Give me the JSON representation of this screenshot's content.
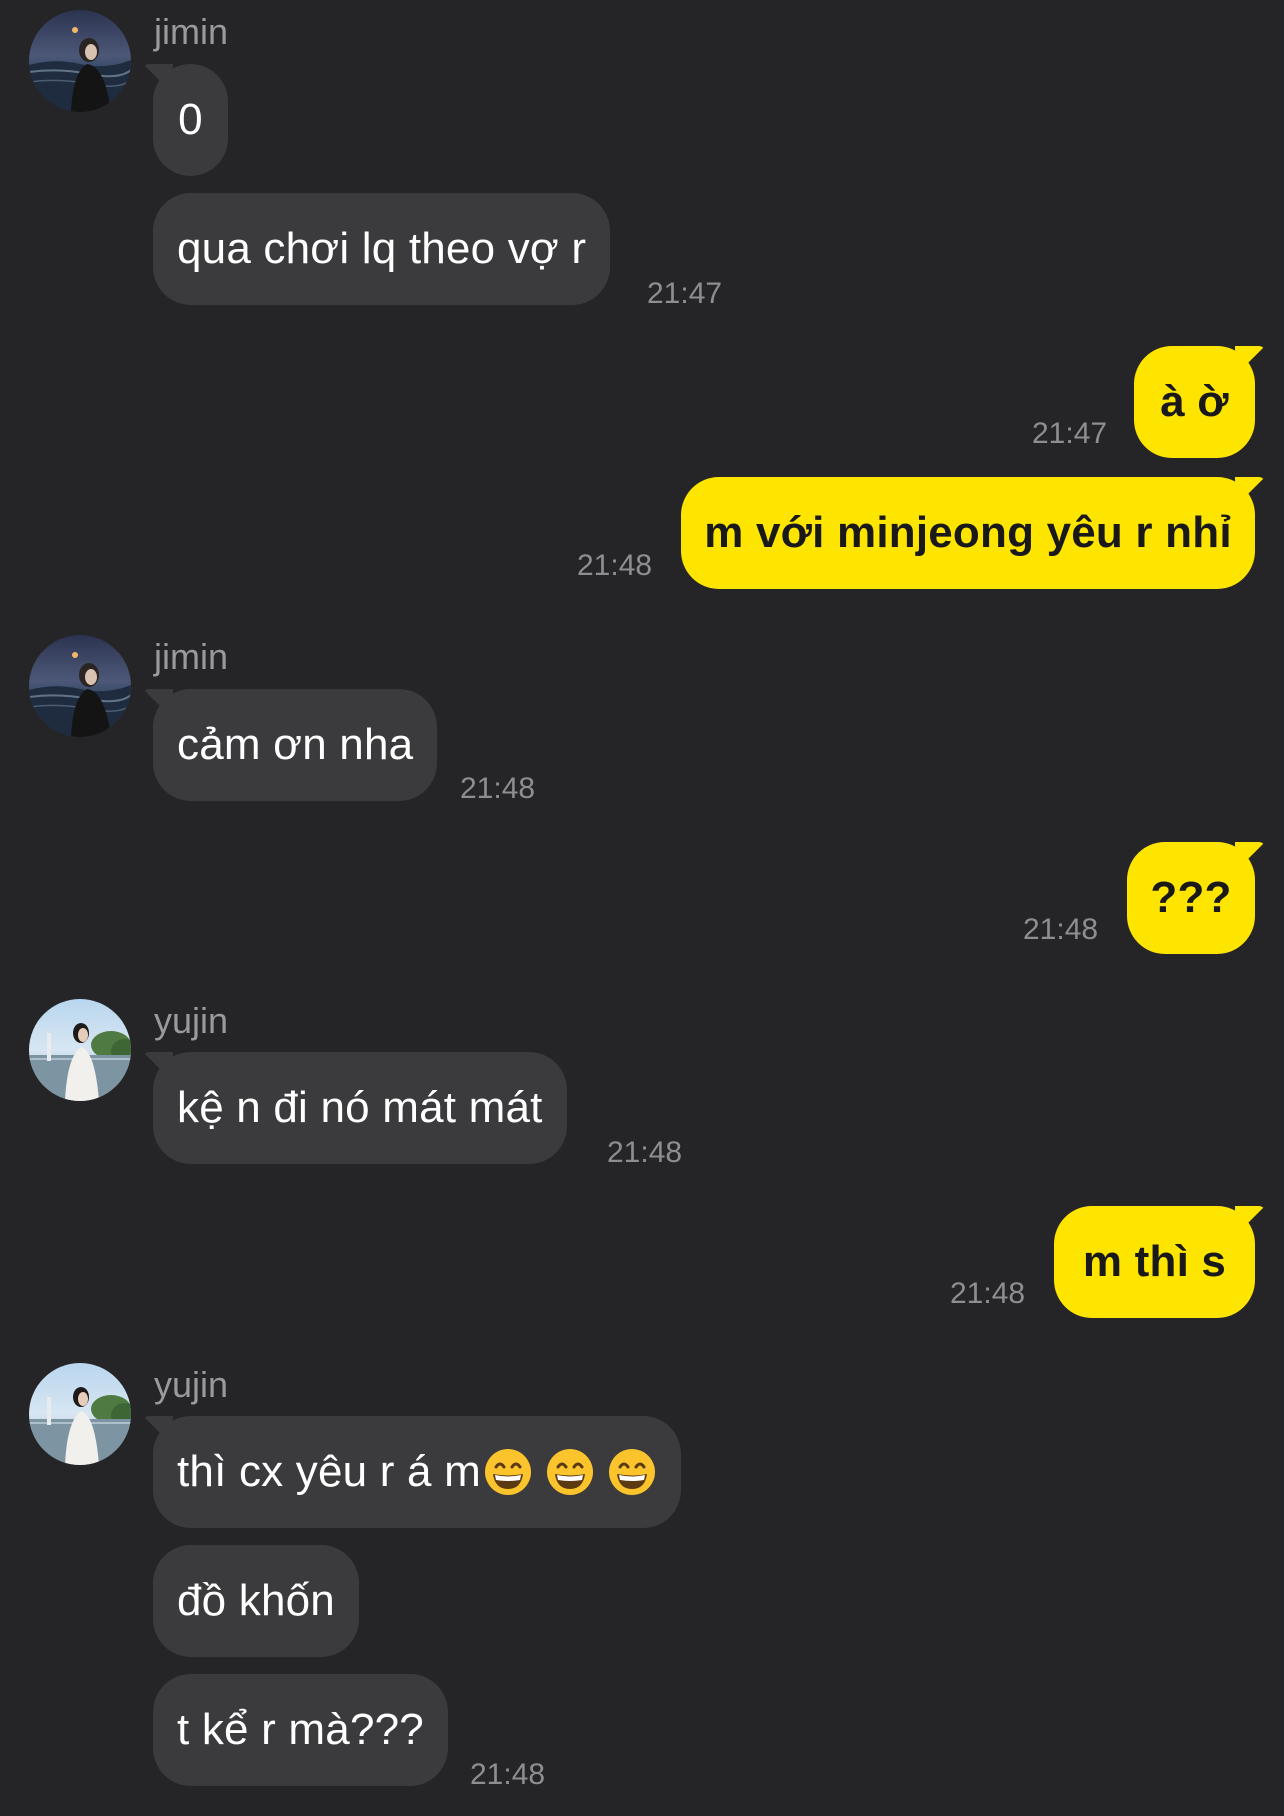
{
  "messages": [
    {
      "sender": "jimin",
      "text": "0"
    },
    {
      "text": "qua chơi lq theo vợ r",
      "time": "21:47"
    },
    {
      "text": "à ờ",
      "time": "21:47"
    },
    {
      "text": "m với minjeong yêu r nhỉ",
      "time": "21:48"
    },
    {
      "sender": "jimin",
      "text": "cảm ơn nha",
      "time": "21:48"
    },
    {
      "text": "???",
      "time": "21:48"
    },
    {
      "sender": "yujin",
      "text": "kệ n đi nó mát mát",
      "time": "21:48"
    },
    {
      "text": "m thì s",
      "time": "21:48"
    },
    {
      "sender": "yujin",
      "text": "thì cx yêu r á m",
      "emoji": [
        "grinning-face-icon",
        "grinning-face-icon",
        "grinning-face-icon"
      ]
    },
    {
      "text": "đồ khốn"
    },
    {
      "text": "t kể r mà???",
      "time": "21:48"
    }
  ],
  "colors": {
    "background": "#252527",
    "incoming_bubble": "#3b3b3d",
    "outgoing_bubble": "#fee500",
    "timestamp": "#8e8e90",
    "sender_name": "#9a9a9c"
  }
}
